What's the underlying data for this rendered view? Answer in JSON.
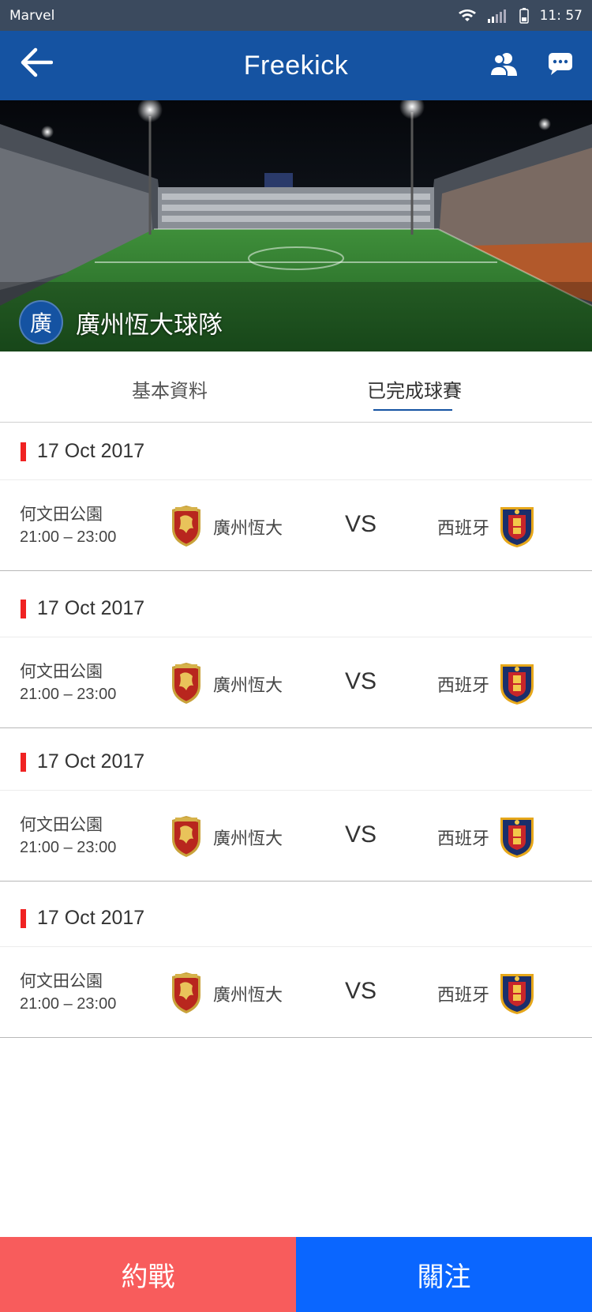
{
  "status_bar": {
    "carrier": "Marvel",
    "time": "11: 57"
  },
  "app_bar": {
    "title": "Freekick"
  },
  "team": {
    "avatar_char": "廣",
    "name": "廣州恆大球隊"
  },
  "tabs": [
    {
      "label": "基本資料",
      "active": false
    },
    {
      "label": "已完成球賽",
      "active": true
    }
  ],
  "matches": [
    {
      "date": "17 Oct 2017",
      "venue": "何文田公園",
      "time": "21:00 – 23:00",
      "home": "廣州恆大",
      "vs": "VS",
      "away": "西班牙"
    },
    {
      "date": "17 Oct 2017",
      "venue": "何文田公園",
      "time": "21:00 – 23:00",
      "home": "廣州恆大",
      "vs": "VS",
      "away": "西班牙"
    },
    {
      "date": "17 Oct 2017",
      "venue": "何文田公園",
      "time": "21:00 – 23:00",
      "home": "廣州恆大",
      "vs": "VS",
      "away": "西班牙"
    },
    {
      "date": "17 Oct 2017",
      "venue": "何文田公園",
      "time": "21:00 – 23:00",
      "home": "廣州恆大",
      "vs": "VS",
      "away": "西班牙"
    }
  ],
  "bottom": {
    "challenge_label": "約戰",
    "follow_label": "關注"
  },
  "colors": {
    "app_bar": "#1553a2",
    "challenge": "#f85c5c",
    "follow": "#0a66ff",
    "date_marker": "#f02222"
  }
}
